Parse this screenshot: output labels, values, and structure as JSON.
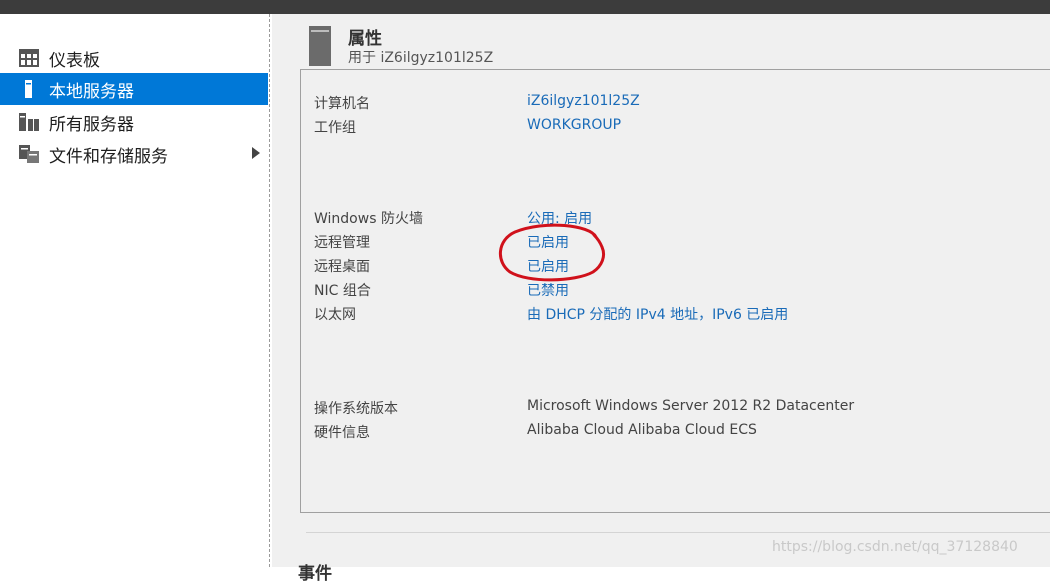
{
  "sidebar": {
    "items": [
      {
        "label": "仪表板",
        "icon": "dashboard-icon"
      },
      {
        "label": "本地服务器",
        "icon": "server-icon",
        "selected": true
      },
      {
        "label": "所有服务器",
        "icon": "servers-icon"
      },
      {
        "label": "文件和存储服务",
        "icon": "file-storage-icon",
        "has_submenu": true
      }
    ]
  },
  "header": {
    "title": "属性",
    "subtitle": "用于 iZ6ilgyz101l25Z"
  },
  "properties": [
    {
      "label": "计算机名",
      "value": "iZ6ilgyz101l25Z",
      "link": true
    },
    {
      "label": "工作组",
      "value": "WORKGROUP",
      "link": true
    },
    {
      "label": "Windows 防火墙",
      "value": "公用: 启用",
      "link": true
    },
    {
      "label": "远程管理",
      "value": "已启用",
      "link": true
    },
    {
      "label": "远程桌面",
      "value": "已启用",
      "link": true
    },
    {
      "label": "NIC 组合",
      "value": "已禁用",
      "link": true
    },
    {
      "label": "以太网",
      "value": "由 DHCP 分配的 IPv4 地址，IPv6 已启用",
      "link": true
    },
    {
      "label": "操作系统版本",
      "value": "Microsoft Windows Server 2012 R2 Datacenter",
      "link": false
    },
    {
      "label": "硬件信息",
      "value": "Alibaba Cloud Alibaba Cloud ECS",
      "link": false
    }
  ],
  "next_section_title": "事件",
  "watermark": "https://blog.csdn.net/qq_37128840",
  "colors": {
    "accent": "#0078d7",
    "link": "#1a6bb8",
    "annotation": "#d0111b"
  }
}
